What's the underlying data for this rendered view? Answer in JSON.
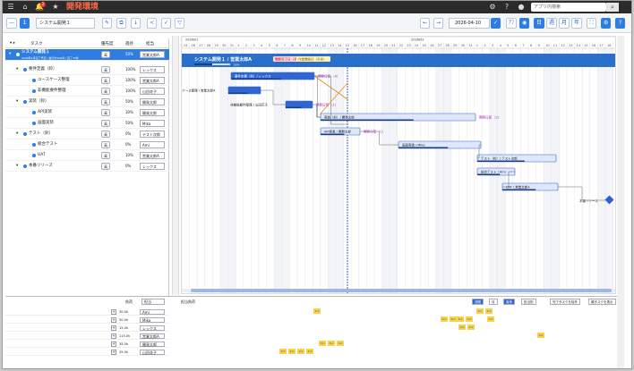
{
  "titlebar": {
    "app_title": "開発環境",
    "search_placeholder": "アプリ内検索",
    "icons": [
      "menu-icon",
      "home-icon",
      "notification-icon",
      "star-icon",
      "settings-icon",
      "help-icon",
      "user-icon",
      "search-icon"
    ],
    "notification_count": "2"
  },
  "toolbar": {
    "project": "システム開発１",
    "date": "2026-04-10",
    "buttons_left": [
      "—",
      "1",
      "✎",
      "⧉",
      "↓",
      "≺",
      "✓",
      "▽"
    ],
    "buttons_right": [
      "←",
      "→",
      "⟳",
      "日",
      "週",
      "月",
      "年",
      "⛶",
      "⚙",
      "?"
    ]
  },
  "left_panel": {
    "headers": {
      "task": "タスク",
      "priority": "優先度",
      "progress": "進捗",
      "owner": "担当"
    },
    "rows": [
      {
        "name": "システム開発１",
        "sub": "2026年1月完了予定 / 進行中100件 / 完了75件",
        "prio": "高",
        "pct": "50%",
        "owner": "営業太郎A",
        "level": 0,
        "highlight": true
      },
      {
        "name": "要件定義（鈴）",
        "prio": "高",
        "pct": "100%",
        "owner": "レックス",
        "level": 1
      },
      {
        "name": "ユースケース整理",
        "prio": "高",
        "pct": "100%",
        "owner": "営業太郎A",
        "level": 2
      },
      {
        "name": "非機能要件整理",
        "prio": "高",
        "pct": "100%",
        "owner": "山田花子",
        "level": 2
      },
      {
        "name": "実装（鈴）",
        "prio": "高",
        "pct": "50%",
        "owner": "開発太郎",
        "level": 1
      },
      {
        "name": "API実装",
        "prio": "高",
        "pct": "30%",
        "owner": "開発太郎",
        "level": 2
      },
      {
        "name": "画面実装",
        "prio": "高",
        "pct": "50%",
        "owner": "Mika",
        "level": 2
      },
      {
        "name": "テスト（鈴）",
        "prio": "高",
        "pct": "0%",
        "owner": "テスト次郎",
        "level": 1
      },
      {
        "name": "総合テスト",
        "prio": "高",
        "pct": "0%",
        "owner": "Ami",
        "level": 2
      },
      {
        "name": "UAT",
        "prio": "高",
        "pct": "10%",
        "owner": "営業太郎A",
        "level": 2
      },
      {
        "name": "本番リリース",
        "prio": "高",
        "pct": "0%",
        "owner": "レックス",
        "level": 1
      }
    ]
  },
  "gantt": {
    "year_labels": [
      "2026/01",
      "2026/02"
    ],
    "project_bar_label": "システム開発１ / 営業太郎A",
    "project_pct": "50%",
    "milestones": [
      {
        "label": "開発完了日（予定）"
      },
      {
        "label": "作業開始日（予定）"
      }
    ],
    "bars": [
      {
        "label": "要件定義（鈴）/ レックス",
        "extra": "開発日程 （4）"
      },
      {
        "label": "ユースケース整理 / 営業太郎A",
        "extra": ""
      },
      {
        "label": "非機能要件整理 / 山田花子",
        "extra": "開発日程 （1）"
      },
      {
        "label": "実装（鈴）/ 開発太郎",
        "extra": "開発日程 （2）"
      },
      {
        "label": "API実装 / 開発太郎",
        "extra": "開発日程 （1）"
      },
      {
        "label": "画面実装 / Mika",
        "extra": ""
      },
      {
        "label": "テスト（鈴）/ テスト次郎",
        "extra": ""
      },
      {
        "label": "総合テスト / Ami",
        "extra": ""
      },
      {
        "label": "UAT / 営業太郎A",
        "extra": ""
      },
      {
        "label": "本番リリース",
        "extra": ""
      }
    ]
  },
  "bottom_panel": {
    "header_left": "負荷",
    "header_select": "担当",
    "header_right_label": "担当負荷",
    "controls": [
      "週間",
      "月",
      "負荷",
      "担当別",
      "完了タスクを除外",
      "親タスクを表示"
    ],
    "rows": [
      {
        "hrs": "30.0h",
        "owner": "Ami"
      },
      {
        "hrs": "30.0h",
        "owner": "Mika"
      },
      {
        "hrs": "15.0h",
        "owner": "レックス"
      },
      {
        "hrs": "115.0h",
        "owner": "営業太郎A"
      },
      {
        "hrs": "35.0h",
        "owner": "開発太郎"
      },
      {
        "hrs": "35.0h",
        "owner": "山田花子"
      }
    ],
    "cell_value": "8.0"
  }
}
